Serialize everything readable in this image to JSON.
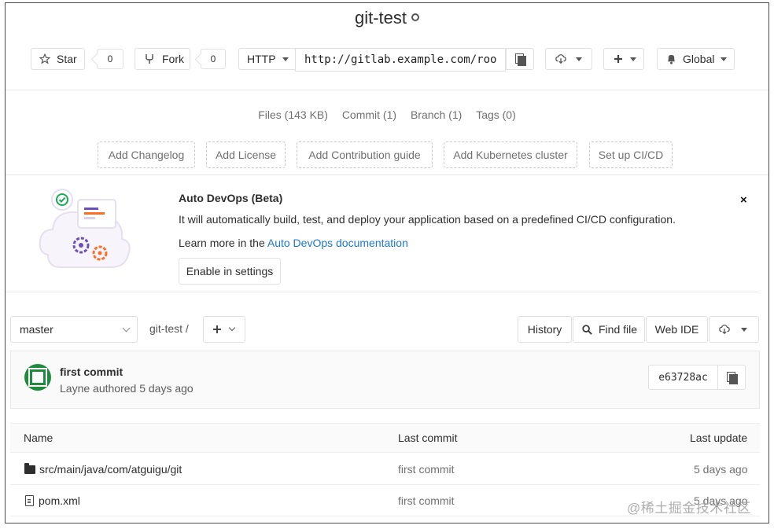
{
  "project": {
    "title": "git-test"
  },
  "header": {
    "star_label": "Star",
    "star_count": "0",
    "fork_label": "Fork",
    "fork_count": "0",
    "protocol": "HTTP",
    "clone_url": "http://gitlab.example.com/roo",
    "notification_label": "Global"
  },
  "stats": {
    "files": "Files (143 KB)",
    "commits": "Commit (1)",
    "branches": "Branch (1)",
    "tags": "Tags (0)"
  },
  "quick_actions": [
    "Add Changelog",
    "Add License",
    "Add Contribution guide",
    "Add Kubernetes cluster",
    "Set up CI/CD"
  ],
  "devops": {
    "title": "Auto DevOps (Beta)",
    "description": "It will automatically build, test, and deploy your application based on a predefined CI/CD configuration.",
    "learn_prefix": "Learn more in the ",
    "learn_link": "Auto DevOps documentation",
    "enable_button": "Enable in settings",
    "close": "×"
  },
  "repo_nav": {
    "branch": "master",
    "path": "git-test /",
    "history": "History",
    "find_file": "Find file",
    "web_ide": "Web IDE"
  },
  "last_commit": {
    "title": "first commit",
    "meta": "Layne authored 5 days ago",
    "sha": "e63728ac"
  },
  "files_table": {
    "headers": {
      "name": "Name",
      "last_commit": "Last commit",
      "last_update": "Last update"
    },
    "rows": [
      {
        "name": "src/main/java/com/atguigu/git",
        "type": "folder",
        "commit": "first commit",
        "updated": "5 days ago"
      },
      {
        "name": "pom.xml",
        "type": "file",
        "commit": "first commit",
        "updated": "5 days ago"
      }
    ]
  },
  "watermark": "@稀土掘金技术社区",
  "colors": {
    "link": "#1f78d1",
    "avatar_green": "#1e8c3c",
    "border": "#e0e0e0",
    "muted_text": "#707070"
  }
}
